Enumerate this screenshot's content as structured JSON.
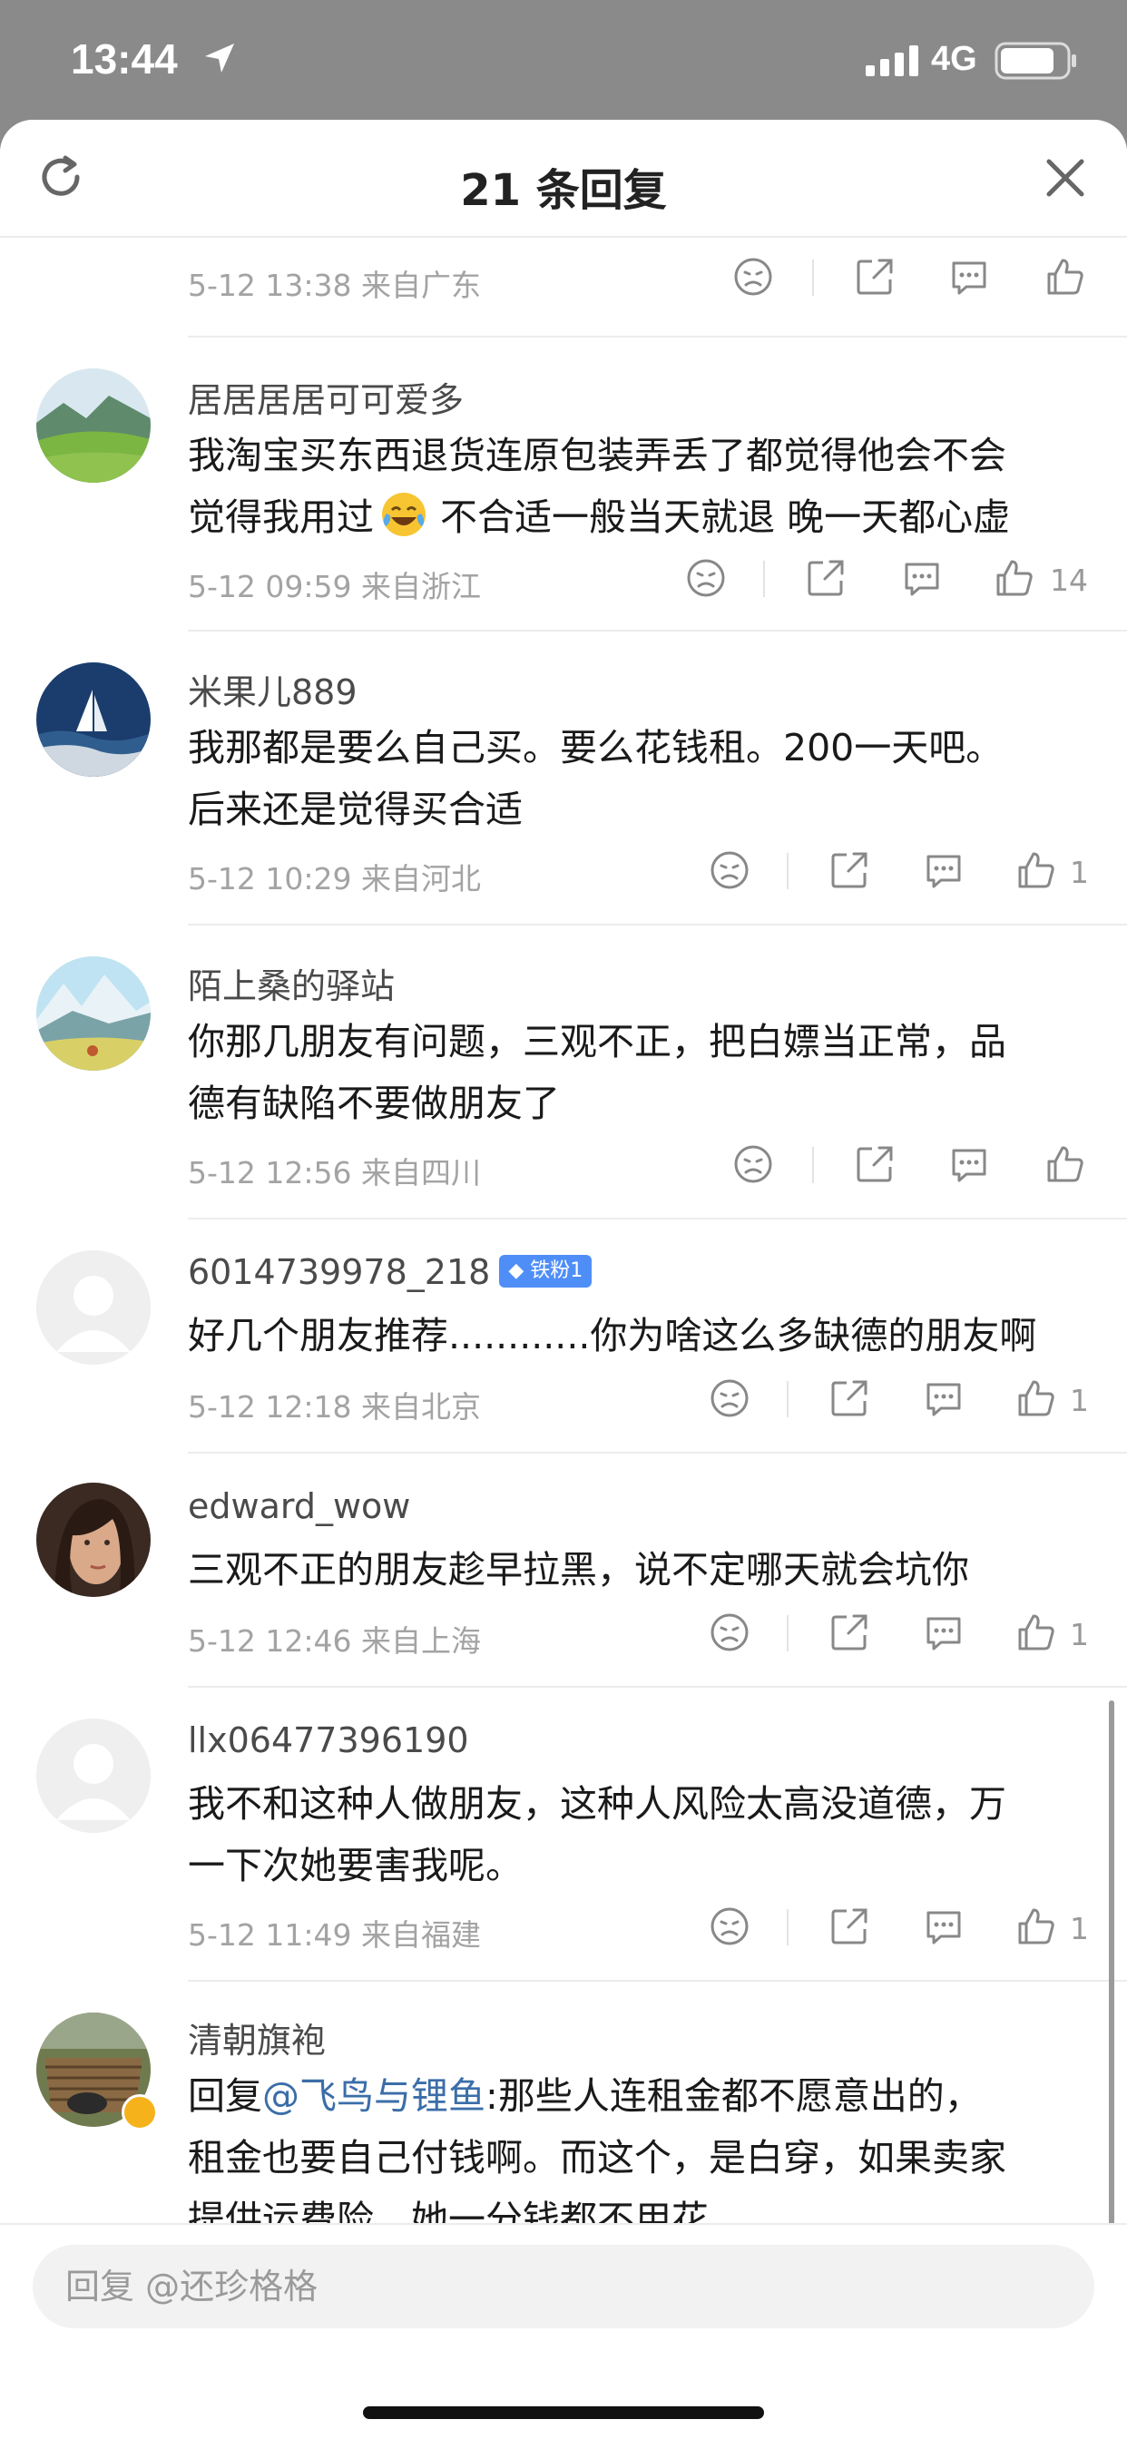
{
  "status_bar": {
    "time": "13:44",
    "network": "4G"
  },
  "header": {
    "title": "21 条回复"
  },
  "comments": [
    {
      "username": "",
      "lines": [],
      "time": "5-12 13:38",
      "location": "来自广东",
      "likes": ""
    },
    {
      "username": "居居居居可可爱多",
      "lines": [
        "我淘宝买东西退货连原包装弄丢了都觉得他会不会",
        "觉得我用过",
        " 不合适一般当天就退 晚一天都心虚"
      ],
      "time": "5-12 09:59",
      "location": "来自浙江",
      "likes": "14"
    },
    {
      "username": "米果儿889",
      "lines": [
        "我那都是要么自己买。要么花钱租。200一天吧。",
        "后来还是觉得买合适"
      ],
      "time": "5-12 10:29",
      "location": "来自河北",
      "likes": "1"
    },
    {
      "username": "陌上桑的驿站",
      "lines": [
        "你那几朋友有问题，三观不正，把白嫖当正常，品",
        "德有缺陷不要做朋友了"
      ],
      "time": "5-12 12:56",
      "location": "来自四川",
      "likes": ""
    },
    {
      "username": "6014739978_218",
      "badge": "铁粉1",
      "lines": [
        "好几个朋友推荐............你为啥这么多缺德的朋友啊"
      ],
      "time": "5-12 12:18",
      "location": "来自北京",
      "likes": "1"
    },
    {
      "username": "edward_wow",
      "lines": [
        "三观不正的朋友趁早拉黑，说不定哪天就会坑你"
      ],
      "time": "5-12 12:46",
      "location": "来自上海",
      "likes": "1"
    },
    {
      "username": "llx06477396190",
      "lines": [
        "我不和这种人做朋友，这种人风险太高没道德，万",
        "一下次她要害我呢。"
      ],
      "time": "5-12 11:49",
      "location": "来自福建",
      "likes": "1"
    },
    {
      "username": "清朝旗袍",
      "reply_prefix": "回复",
      "mention": "@飞鸟与锂鱼",
      "lines": [
        ":那些人连租金都不愿意出的，",
        "租金也要自己付钱啊。而这个，是白穿，如果卖家",
        "提供运费险，她一分钱都不用花。"
      ]
    }
  ],
  "reply_box": {
    "placeholder": "回复 @还珍格格"
  },
  "colors": {
    "mention": "#3b6ea8",
    "badge": "#4f8ef7",
    "vip": "#f5b21b"
  }
}
